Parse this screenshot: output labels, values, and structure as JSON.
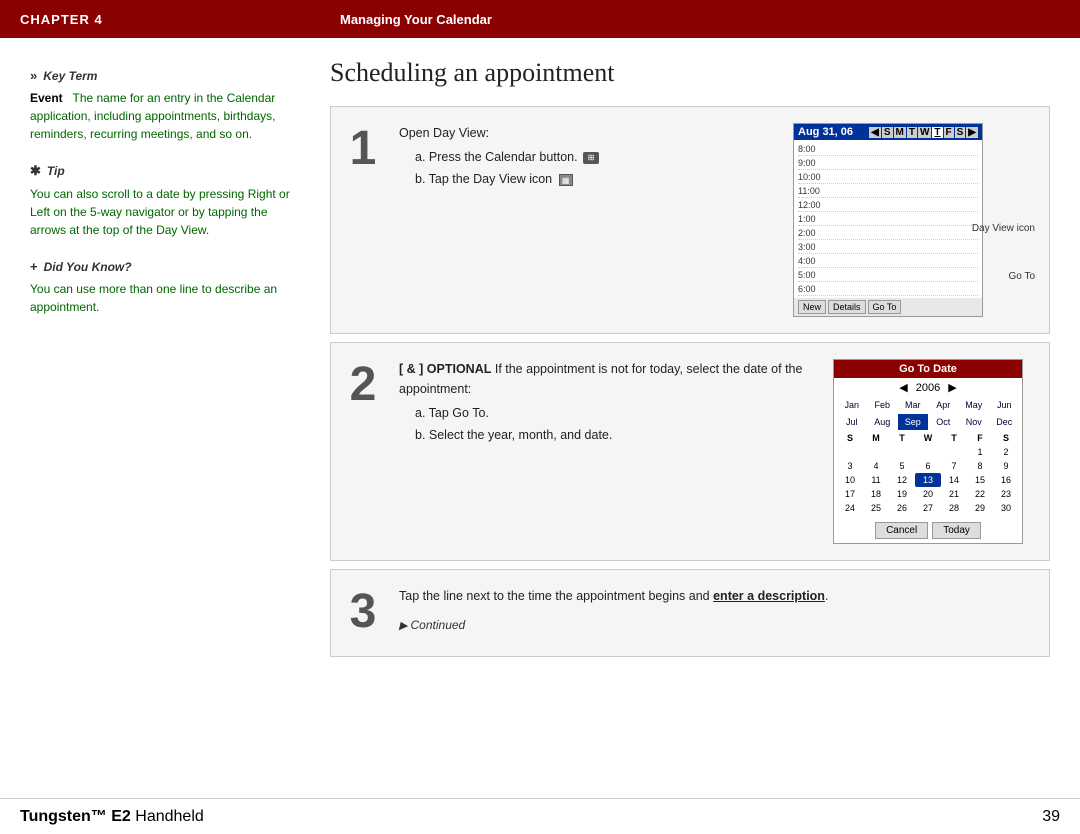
{
  "header": {
    "chapter": "CHAPTER 4",
    "title": "Managing Your Calendar"
  },
  "footer": {
    "brand": "Tungsten™ E2",
    "brand_suffix": " Handheld",
    "page": "39"
  },
  "sidebar": {
    "key_term_header": "Key Term",
    "key_term_word": "Event",
    "key_term_text": "The name for an entry in the Calendar application, including appointments, birthdays, reminders, recurring meetings, and so on.",
    "tip_header": "Tip",
    "tip_text": "You can also scroll to a date by pressing Right or Left on the 5-way navigator or by tapping the arrows at the top of the Day View.",
    "did_you_know_header": "Did You Know?",
    "did_you_know_text": "You can use more than one line to describe an appointment."
  },
  "page_title": "Scheduling an appointment",
  "steps": {
    "step1": {
      "number": "1",
      "title": "Open Day View:",
      "sub_a": "a.  Press the Calendar       button.",
      "sub_b": "b.  Tap the Day View icon",
      "dayview": {
        "date": "Aug 31, 06",
        "days": [
          "S",
          "M",
          "T",
          "W",
          "T",
          "F",
          "S"
        ],
        "active_day": "T",
        "times": [
          "8:00",
          "9:00",
          "10:00",
          "11:00",
          "12:00",
          "1:00",
          "2:00",
          "3:00",
          "4:00",
          "5:00",
          "6:00"
        ],
        "label_day_view": "Day View icon",
        "label_go_to": "Go To",
        "footer_buttons": [
          "New",
          "Details",
          "Go To"
        ]
      }
    },
    "step2": {
      "number": "2",
      "optional_label": "[ & ]  OPTIONAL",
      "optional_text": "  If the appointment is not for today, select the date of the appointment:",
      "sub_a": "a.  Tap Go To.",
      "sub_b": "b.  Select the year, month, and date.",
      "gotodate": {
        "header": "Go To Date",
        "year": "2006",
        "months_row1": [
          "Jan",
          "Feb",
          "Mar",
          "Apr",
          "May",
          "Jun"
        ],
        "months_row2": [
          "Jul",
          "Aug",
          "Sep",
          "Oct",
          "Nov",
          "Dec"
        ],
        "active_month": "Sep",
        "day_headers": [
          "S",
          "M",
          "T",
          "W",
          "T",
          "F",
          "S"
        ],
        "weeks": [
          [
            "",
            "",
            "",
            "",
            "",
            "1",
            "2"
          ],
          [
            "3",
            "4",
            "5",
            "6",
            "7",
            "8",
            "9"
          ],
          [
            "10",
            "11",
            "12",
            "13",
            "14",
            "15",
            "16"
          ],
          [
            "17",
            "18",
            "19",
            "20",
            "21",
            "22",
            "23"
          ],
          [
            "24",
            "25",
            "26",
            "27",
            "28",
            "29",
            "30"
          ]
        ],
        "today": "13",
        "footer_buttons": [
          "Cancel",
          "Today"
        ]
      }
    },
    "step3": {
      "number": "3",
      "text_before": "Tap the line next to the time the appointment begins and ",
      "text_bold": "enter a description",
      "text_after": ".",
      "continued": "Continued"
    }
  }
}
